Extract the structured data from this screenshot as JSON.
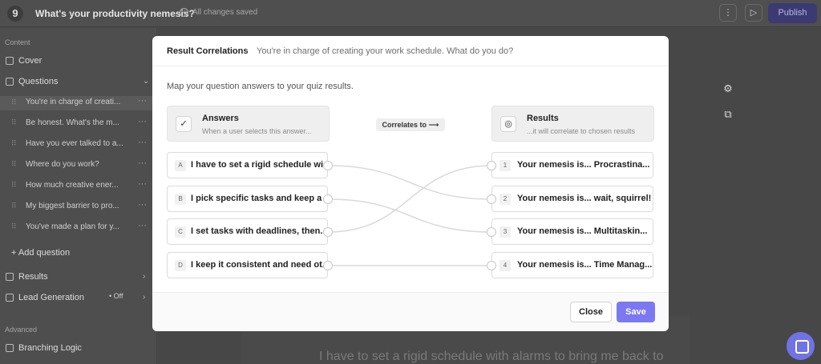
{
  "app": {
    "logo": "9",
    "title": "What's your productivity nemesis?",
    "save_status": "All changes saved",
    "more_icon": "⋮",
    "preview_icon": "▷",
    "publish_label": "Publish"
  },
  "sidebar": {
    "content_label": "Content",
    "cover_label": "Cover",
    "questions_label": "Questions",
    "questions": [
      "You're in charge of creati...",
      "Be honest. What's the m...",
      "Have you ever talked to a...",
      "Where do you work?",
      "How much creative ener...",
      "My biggest barrier to pro...",
      "You've made a plan for y..."
    ],
    "add_question_label": "+ Add question",
    "results_label": "Results",
    "lead_generation_label": "Lead Generation",
    "lead_generation_toggle": "• Off",
    "advanced_label": "Advanced",
    "branching_label": "Branching Logic"
  },
  "background": {
    "answer_preview": "I have to set a rigid schedule with alarms to bring me back to"
  },
  "modal": {
    "breadcrumb_root": "Result Correlations",
    "breadcrumb_separator": "›",
    "breadcrumb_question": "You're in charge of creating your work schedule. What do you do?",
    "description": "Map your question answers to your quiz results.",
    "answers_header": {
      "title": "Answers",
      "subtitle": "When a user selects this answer..."
    },
    "correlates_label": "Correlates to ⟶",
    "results_header": {
      "title": "Results",
      "subtitle": "...it will correlate to chosen results"
    },
    "answers": [
      {
        "badge": "A",
        "text": "I have to set a rigid schedule wi..."
      },
      {
        "badge": "B",
        "text": "I pick specific tasks and keep a ..."
      },
      {
        "badge": "C",
        "text": "I set tasks with deadlines, then..."
      },
      {
        "badge": "D",
        "text": "I keep it consistent and need ot..."
      }
    ],
    "results": [
      {
        "badge": "1",
        "text": "Your nemesis is... Procrastina..."
      },
      {
        "badge": "2",
        "text": "Your nemesis is... wait, squirrel!"
      },
      {
        "badge": "3",
        "text": "Your nemesis is... Multitaskin..."
      },
      {
        "badge": "4",
        "text": "Your nemesis is... Time Manag..."
      }
    ],
    "connections": [
      {
        "answer": "A",
        "result": "2"
      },
      {
        "answer": "B",
        "result": "3"
      },
      {
        "answer": "C",
        "result": "1"
      },
      {
        "answer": "D",
        "result": "4"
      }
    ],
    "close_label": "Close",
    "save_label": "Save"
  },
  "colors": {
    "accent": "#7b78f2",
    "overlay_bg": "#4a4a4a"
  }
}
